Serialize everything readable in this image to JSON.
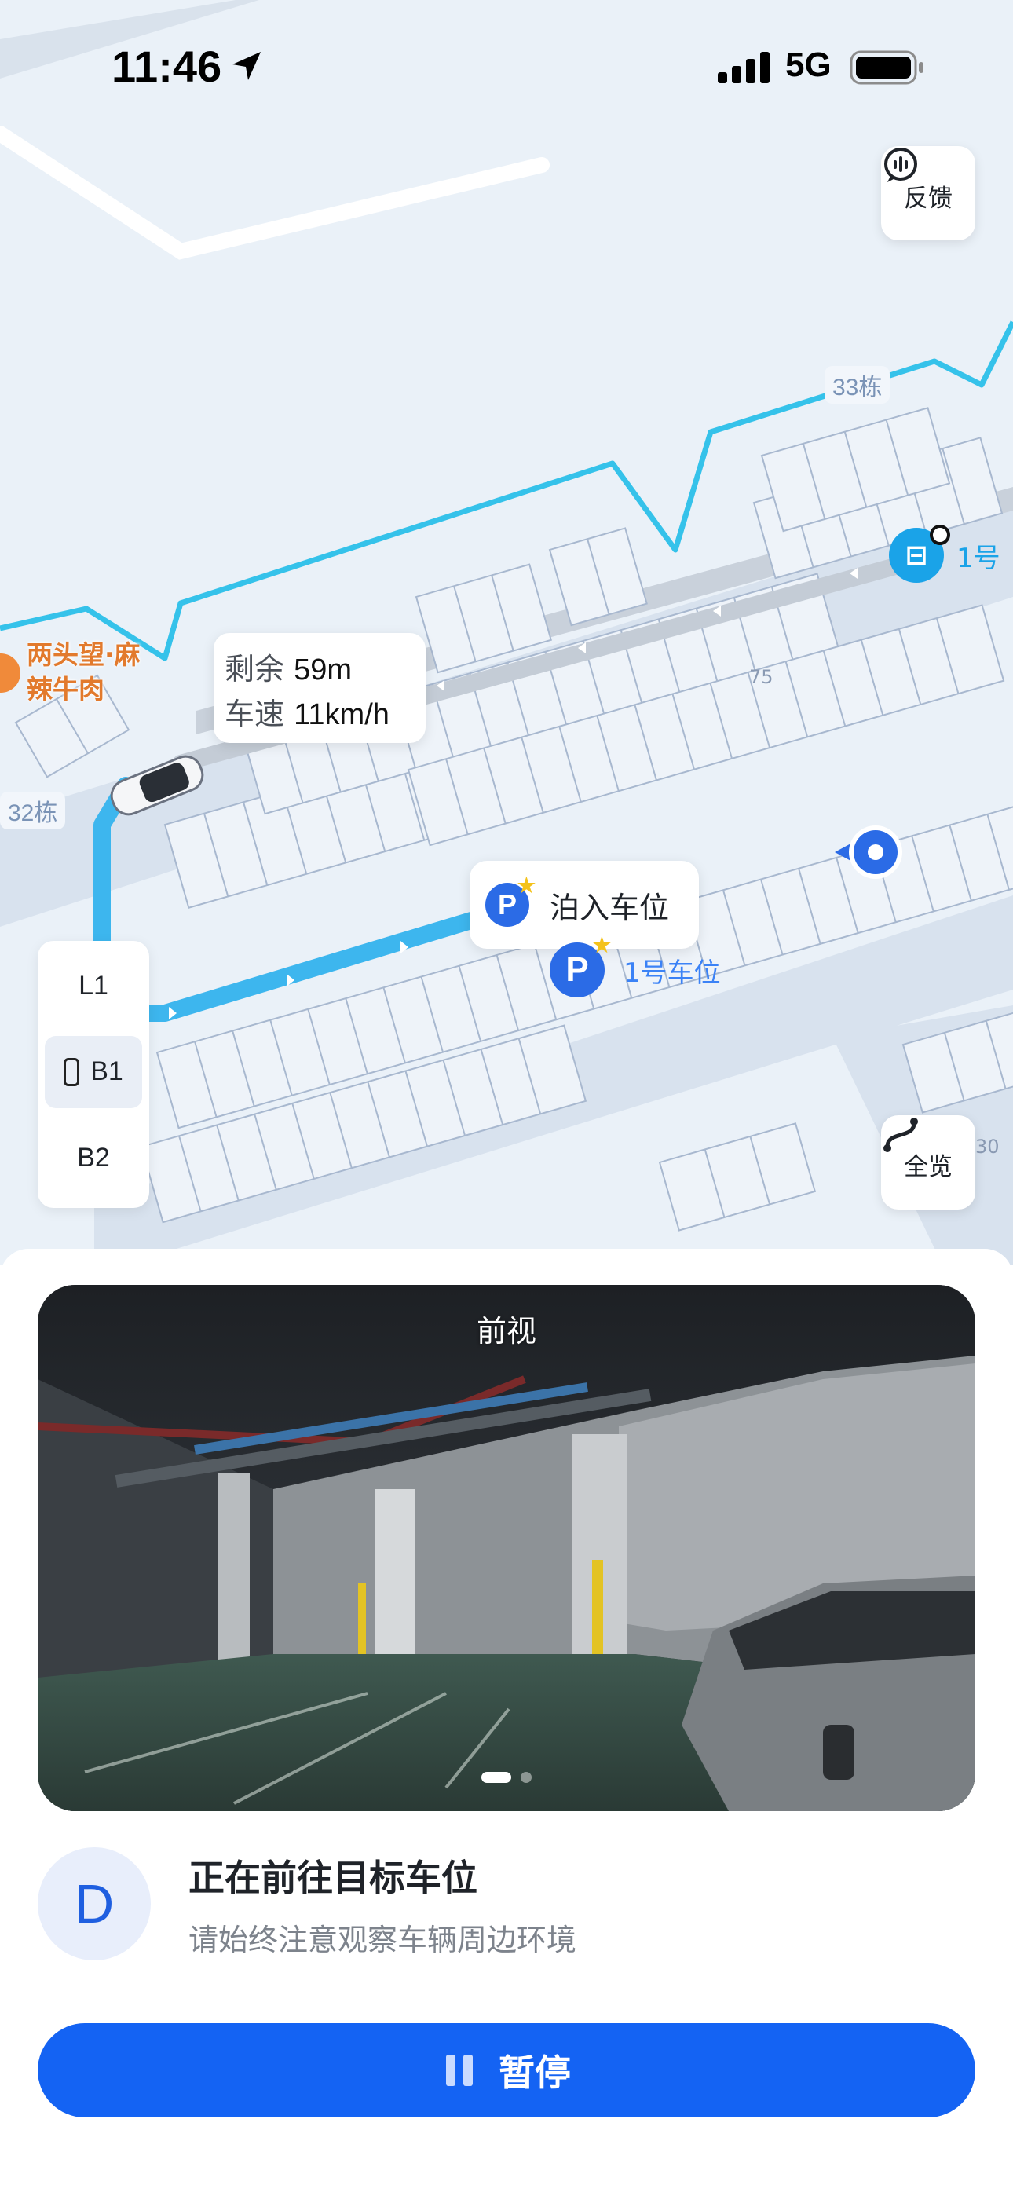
{
  "status_bar": {
    "time": "11:46",
    "network": "5G",
    "icons": [
      "location-arrow-icon",
      "signal-icon",
      "battery-icon"
    ]
  },
  "map": {
    "feedback_label": "反馈",
    "overview_label": "全览",
    "info": {
      "remaining_label": "剩余",
      "remaining_value": "59m",
      "speed_label": "车速",
      "speed_value": "11km/h"
    },
    "park_action": "泊入车位",
    "target_spot": "1号车位",
    "gate_label": "1号",
    "restaurant": [
      "两头望·麻",
      "辣牛肉"
    ],
    "buildings": [
      "33栋",
      "32栋"
    ],
    "numbers": [
      "75",
      "30"
    ],
    "floors": [
      {
        "label": "L1",
        "active": false
      },
      {
        "label": "B1",
        "active": true
      },
      {
        "label": "B2",
        "active": false
      }
    ],
    "colors": {
      "route": "#3db6ee",
      "path": "#35c2ea",
      "accent": "#2b6be6"
    }
  },
  "camera": {
    "title": "前视",
    "pages": 2,
    "current_page": 1
  },
  "status": {
    "gear": "D",
    "title": "正在前往目标车位",
    "subtitle": "请始终注意观察车辆周边环境"
  },
  "pause_button": {
    "label": "暂停",
    "color": "#1463f3"
  }
}
